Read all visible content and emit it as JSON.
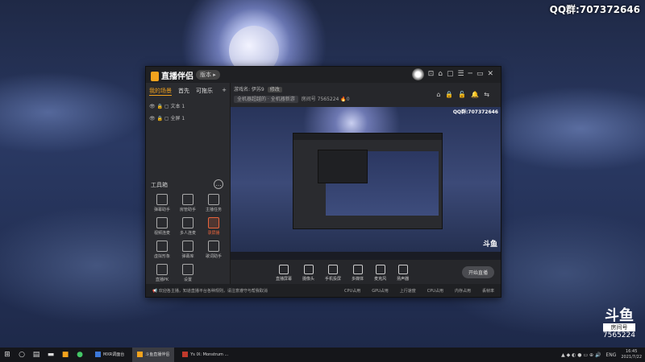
{
  "overlay": {
    "qq": "QQ群:707372646"
  },
  "app": {
    "title": "直播伴侣",
    "version": "版本 ▸",
    "tabs": [
      "我的场景",
      "首先",
      "可拖乐"
    ],
    "scenes": [
      "文本 1",
      "全屏 1"
    ],
    "tools_title": "工具箱",
    "tools": [
      "弹幕助手",
      "房管助手",
      "主播任务",
      "视频连麦",
      "多人连麦",
      "录屏播",
      "虚拟形象",
      "弹幕库",
      "歌词助手",
      "直播PK",
      "设置"
    ],
    "info": {
      "game": "游戏名: 伊苏9",
      "change": "修改",
      "category": "全机器超越的 · 全机器新游",
      "room": "房间号 7565224",
      "heat": "0"
    },
    "preview_qq": "QQ群:707372646",
    "controls": [
      "直播屏幕",
      "摄像头",
      "手机投屏",
      "多媒体",
      "麦克风",
      "扬声器"
    ],
    "start_live": "开始直播",
    "notice": "欢迎各主播，知道直播平台各种规则，请注意遵守与帮我取消",
    "stats": [
      "CPU占用",
      "GPU占用",
      "上行速度",
      "CPU占用",
      "内存占用",
      "丢帧率"
    ]
  },
  "douyu": {
    "logo": "斗鱼",
    "label": "房间号",
    "room": "7565224"
  },
  "taskbar": {
    "tasks": [
      {
        "label": "MXR调面台",
        "color": "#3c78d8"
      },
      {
        "label": "斗鱼直播伴侣",
        "color": "#f3a31d"
      },
      {
        "label": "Ys IX: Monstrum ...",
        "color": "#c0392b"
      }
    ],
    "lang": "ENG",
    "time": "16:45",
    "date": "2021/7/22"
  }
}
